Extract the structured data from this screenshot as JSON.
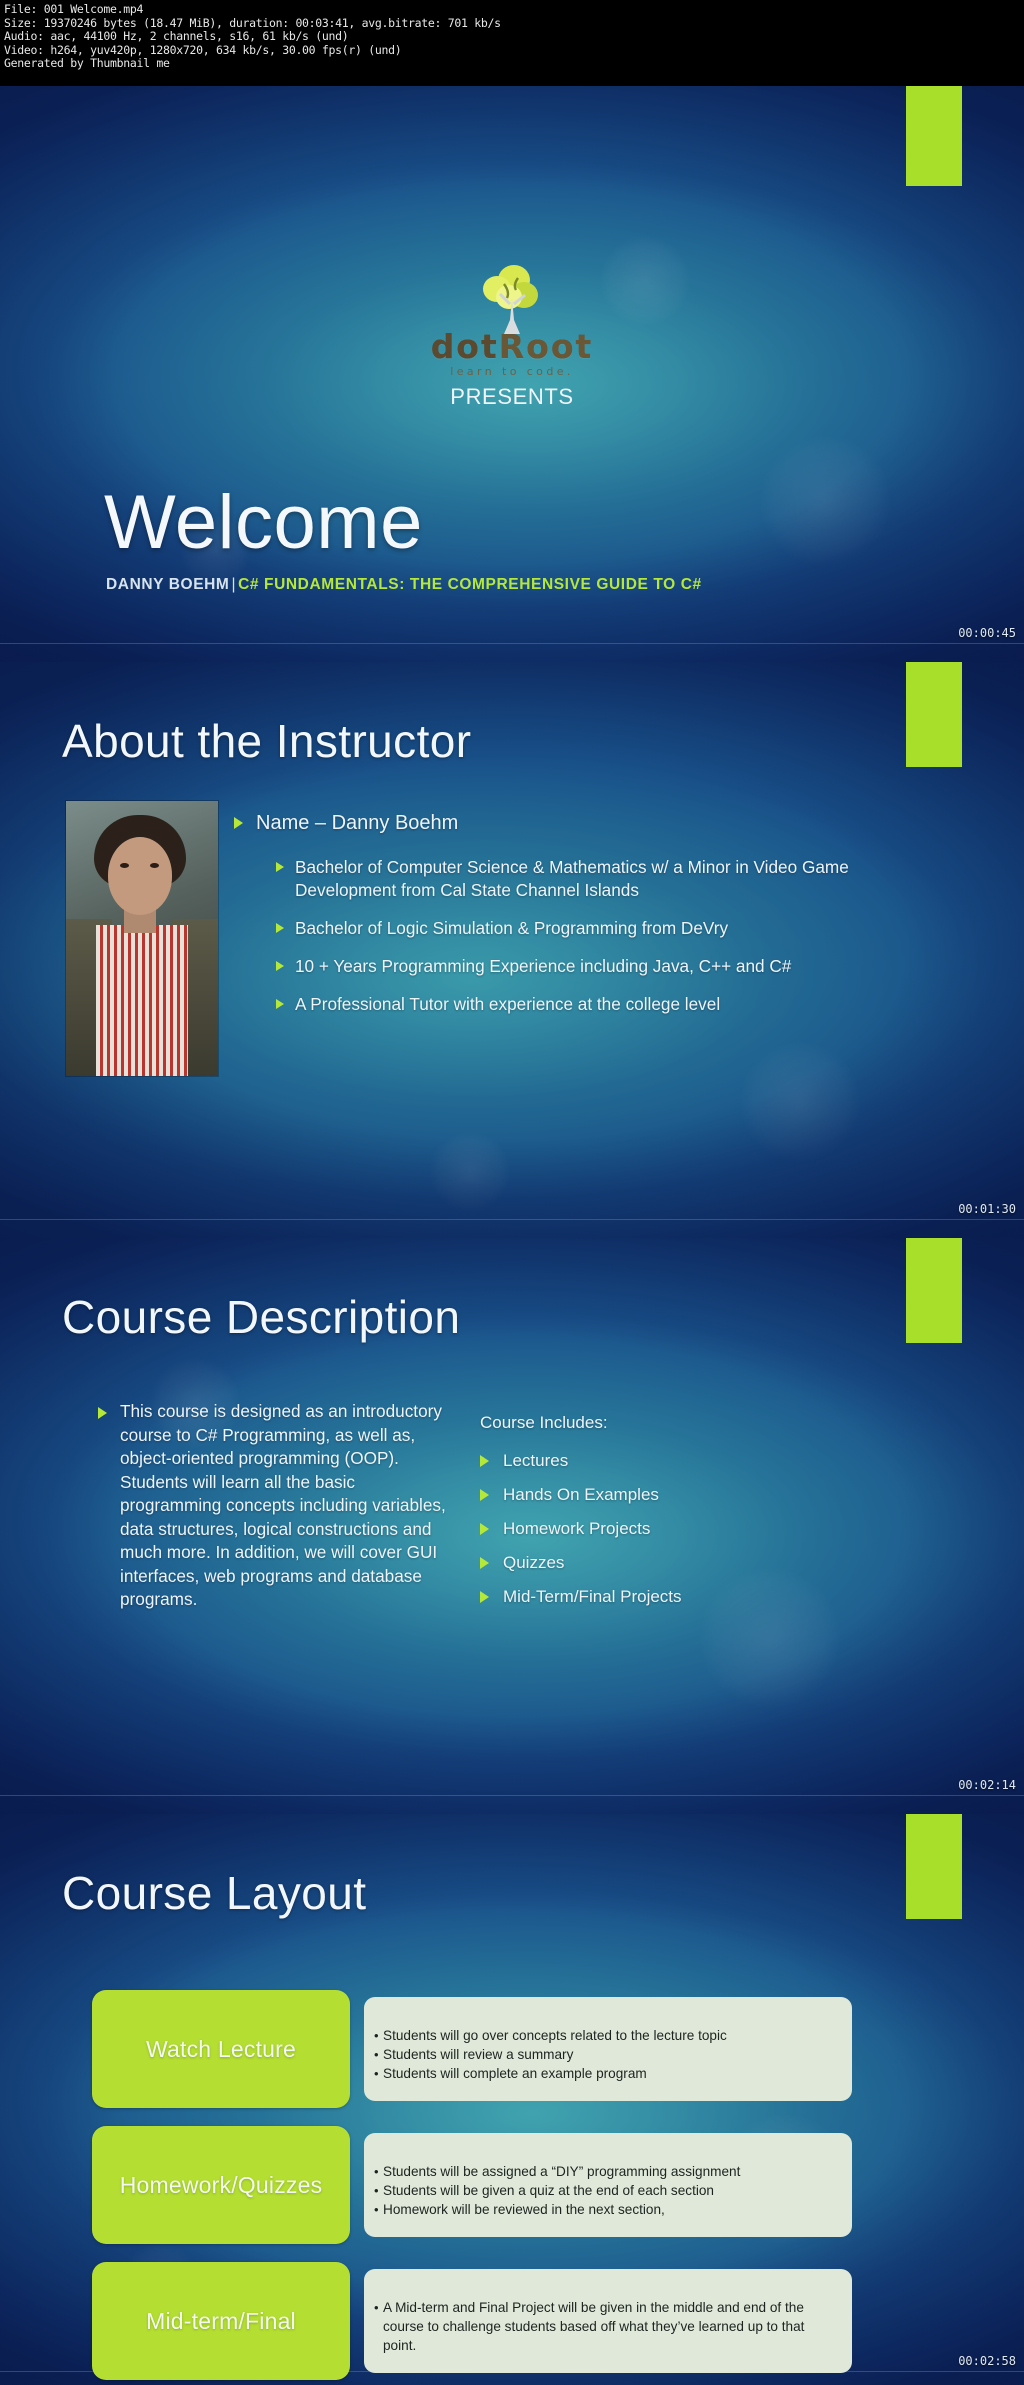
{
  "meta": {
    "lines": [
      "File: 001 Welcome.mp4",
      "Size: 19370246 bytes (18.47 MiB), duration: 00:03:41, avg.bitrate: 701 kb/s",
      "Audio: aac, 44100 Hz, 2 channels, s16, 61 kb/s (und)",
      "Video: h264, yuv420p, 1280x720, 634 kb/s, 30.00 fps(r) (und)",
      "Generated by Thumbnail me"
    ]
  },
  "slides": [
    {
      "timestamp": "00:00:45",
      "logo": {
        "word_a": "dot",
        "word_b": "Root",
        "tagline": "learn to code.",
        "icon": "tree-icon"
      },
      "presents": "PRESENTS",
      "title": "Welcome",
      "author": "DANNY BOEHM",
      "separator": "|",
      "course": "C# FUNDAMENTALS: THE COMPREHENSIVE GUIDE TO C#"
    },
    {
      "timestamp": "00:01:30",
      "title": "About the Instructor",
      "portrait_alt": "instructor-photo",
      "bullets": [
        {
          "level": 1,
          "text": "Name – Danny Boehm"
        },
        {
          "level": 2,
          "text": "Bachelor of Computer Science & Mathematics w/ a Minor in Video Game Development from Cal State Channel Islands"
        },
        {
          "level": 2,
          "text": "Bachelor of Logic Simulation & Programming from DeVry"
        },
        {
          "level": 2,
          "text": "10 + Years Programming Experience including Java, C++ and C#"
        },
        {
          "level": 2,
          "text": "A Professional Tutor with experience at the college level"
        }
      ]
    },
    {
      "timestamp": "00:02:14",
      "title": "Course Description",
      "description": "This course is designed as an introductory course to C# Programming, as well as, object-oriented programming (OOP). Students will learn all the basic programming concepts including variables, data structures, logical constructions and much more. In addition, we will cover GUI interfaces, web programs and database programs.",
      "includes_heading": "Course Includes:",
      "includes": [
        "Lectures",
        "Hands On Examples",
        "Homework Projects",
        "Quizzes",
        "Mid-Term/Final Projects"
      ]
    },
    {
      "timestamp": "00:02:58",
      "title": "Course Layout",
      "rows": [
        {
          "label": "Watch Lecture",
          "points": [
            "Students will go over concepts related to the lecture topic",
            "Students will review a summary",
            "Students will complete an example program"
          ]
        },
        {
          "label": "Homework/Quizzes",
          "points": [
            "Students will be assigned a “DIY” programming assignment",
            "Students will be given a quiz at the end of each section",
            "Homework will be reviewed in the next section,"
          ]
        },
        {
          "label": "Mid-term/Final",
          "points": [
            "A Mid-term and Final Project will be given in the middle and end of the course to challenge students based off what they’ve learned up to that point."
          ]
        }
      ]
    }
  ],
  "colors": {
    "accent_green": "#b4de31",
    "bullet_green": "#b6e838",
    "box_fill": "#dfe8d9",
    "slide_blue_deep": "#0a1a52",
    "slide_teal": "#2a7fa0",
    "title_text": "#f2f7fb"
  }
}
